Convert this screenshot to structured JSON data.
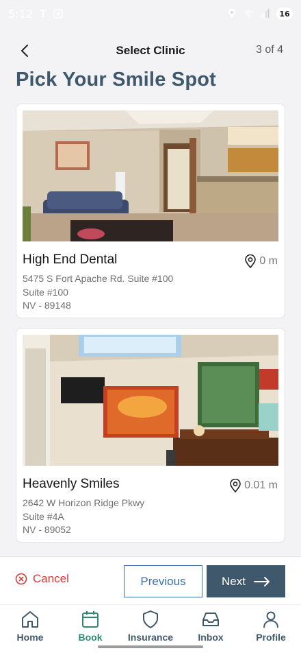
{
  "status_bar": {
    "time": "5:12",
    "battery": "16"
  },
  "header": {
    "title": "Select Clinic",
    "step": "3 of 4"
  },
  "page_title": "Pick Your Smile Spot",
  "clinics": [
    {
      "name": "High End Dental",
      "distance": "0 m",
      "address_line1": "5475 S Fort Apache Rd. Suite #100",
      "address_line2": "Suite #100",
      "address_line3": "NV - 89148"
    },
    {
      "name": "Heavenly Smiles",
      "distance": "0.01 m",
      "address_line1": "2642 W Horizon Ridge Pkwy",
      "address_line2": "Suite #4A",
      "address_line3": "NV - 89052"
    }
  ],
  "actions": {
    "cancel": "Cancel",
    "previous": "Previous",
    "next": "Next"
  },
  "nav": [
    {
      "label": "Home",
      "icon": "home-icon"
    },
    {
      "label": "Book",
      "icon": "calendar-icon"
    },
    {
      "label": "Insurance",
      "icon": "shield-icon"
    },
    {
      "label": "Inbox",
      "icon": "inbox-icon"
    },
    {
      "label": "Profile",
      "icon": "user-icon"
    }
  ],
  "colors": {
    "primary": "#3f586c",
    "accent": "#2c8a74",
    "danger": "#d73a35",
    "link": "#3e6fb3"
  }
}
